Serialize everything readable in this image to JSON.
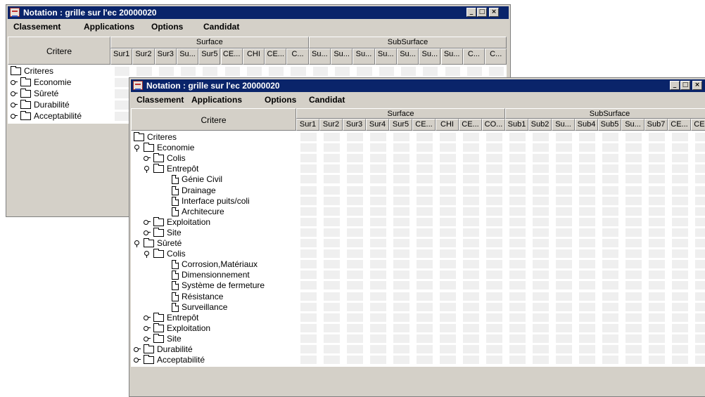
{
  "window_back": {
    "title": "Notation : grille sur l'ec 20000020",
    "menu": [
      "Classement",
      "Applications",
      "Options",
      "Candidat"
    ],
    "critere_header": "Critere",
    "groups": [
      {
        "label": "Surface",
        "columns": [
          "Sur1",
          "Sur2",
          "Sur3",
          "Su...",
          "Sur5",
          "CE...",
          "CHI",
          "CE...",
          "C..."
        ]
      },
      {
        "label": "SubSurface",
        "columns": [
          "Su...",
          "Su...",
          "Su...",
          "Su...",
          "Su...",
          "Su...",
          "Su...",
          "C...",
          "C..."
        ]
      }
    ],
    "tree": [
      {
        "label": "Criteres",
        "level": 0,
        "type": "folder",
        "expander": "none"
      },
      {
        "label": "Economie",
        "level": 1,
        "type": "folder",
        "expander": "collapsed"
      },
      {
        "label": "Sûreté",
        "level": 1,
        "type": "folder",
        "expander": "collapsed"
      },
      {
        "label": "Durabilité",
        "level": 1,
        "type": "folder",
        "expander": "collapsed"
      },
      {
        "label": "Acceptabilité",
        "level": 1,
        "type": "folder",
        "expander": "collapsed"
      }
    ]
  },
  "window_front": {
    "title": "Notation : grille sur l'ec 20000020",
    "menu": [
      "Classement",
      "Applications",
      "Options",
      "Candidat"
    ],
    "critere_header": "Critere",
    "groups": [
      {
        "label": "Surface",
        "columns": [
          "Sur1",
          "Sur2",
          "Sur3",
          "Sur4",
          "Sur5",
          "CE...",
          "CHI",
          "CE...",
          "CO..."
        ]
      },
      {
        "label": "SubSurface",
        "columns": [
          "Sub1",
          "Sub2",
          "Su...",
          "Sub4",
          "Sub5",
          "Su...",
          "Sub7",
          "CE...",
          "CE..."
        ]
      }
    ],
    "tree": [
      {
        "label": "Criteres",
        "level": 0,
        "type": "folder",
        "expander": "none"
      },
      {
        "label": "Economie",
        "level": 1,
        "type": "folder",
        "expander": "expanded"
      },
      {
        "label": "Colis",
        "level": 2,
        "type": "folder",
        "expander": "collapsed"
      },
      {
        "label": "Entrepôt",
        "level": 2,
        "type": "folder",
        "expander": "expanded"
      },
      {
        "label": "Génie Civil",
        "level": 3,
        "type": "doc",
        "expander": "none"
      },
      {
        "label": "Drainage",
        "level": 3,
        "type": "doc",
        "expander": "none"
      },
      {
        "label": "Interface puits/coli",
        "level": 3,
        "type": "doc",
        "expander": "none"
      },
      {
        "label": "Architecure",
        "level": 3,
        "type": "doc",
        "expander": "none"
      },
      {
        "label": "Exploitation",
        "level": 2,
        "type": "folder",
        "expander": "collapsed"
      },
      {
        "label": "Site",
        "level": 2,
        "type": "folder",
        "expander": "collapsed"
      },
      {
        "label": "Sûreté",
        "level": 1,
        "type": "folder",
        "expander": "expanded"
      },
      {
        "label": "Colis",
        "level": 2,
        "type": "folder",
        "expander": "expanded"
      },
      {
        "label": "Corrosion,Matériaux",
        "level": 3,
        "type": "doc",
        "expander": "none"
      },
      {
        "label": "Dimensionnement",
        "level": 3,
        "type": "doc",
        "expander": "none"
      },
      {
        "label": "Système de fermeture",
        "level": 3,
        "type": "doc",
        "expander": "none"
      },
      {
        "label": "Résistance",
        "level": 3,
        "type": "doc",
        "expander": "none"
      },
      {
        "label": "Surveillance",
        "level": 3,
        "type": "doc",
        "expander": "none"
      },
      {
        "label": "Entrepôt",
        "level": 2,
        "type": "folder",
        "expander": "collapsed"
      },
      {
        "label": "Exploitation",
        "level": 2,
        "type": "folder",
        "expander": "collapsed"
      },
      {
        "label": "Site",
        "level": 2,
        "type": "folder",
        "expander": "collapsed"
      },
      {
        "label": "Durabilité",
        "level": 1,
        "type": "folder",
        "expander": "collapsed"
      },
      {
        "label": "Acceptabilité",
        "level": 1,
        "type": "folder",
        "expander": "collapsed"
      }
    ]
  },
  "window_buttons": {
    "minimize": "_",
    "maximize": "□",
    "close": "×"
  },
  "colors": {
    "title_bar": "#0a246a",
    "window_face": "#d4d0c8",
    "grid_cell": "#efefef"
  }
}
